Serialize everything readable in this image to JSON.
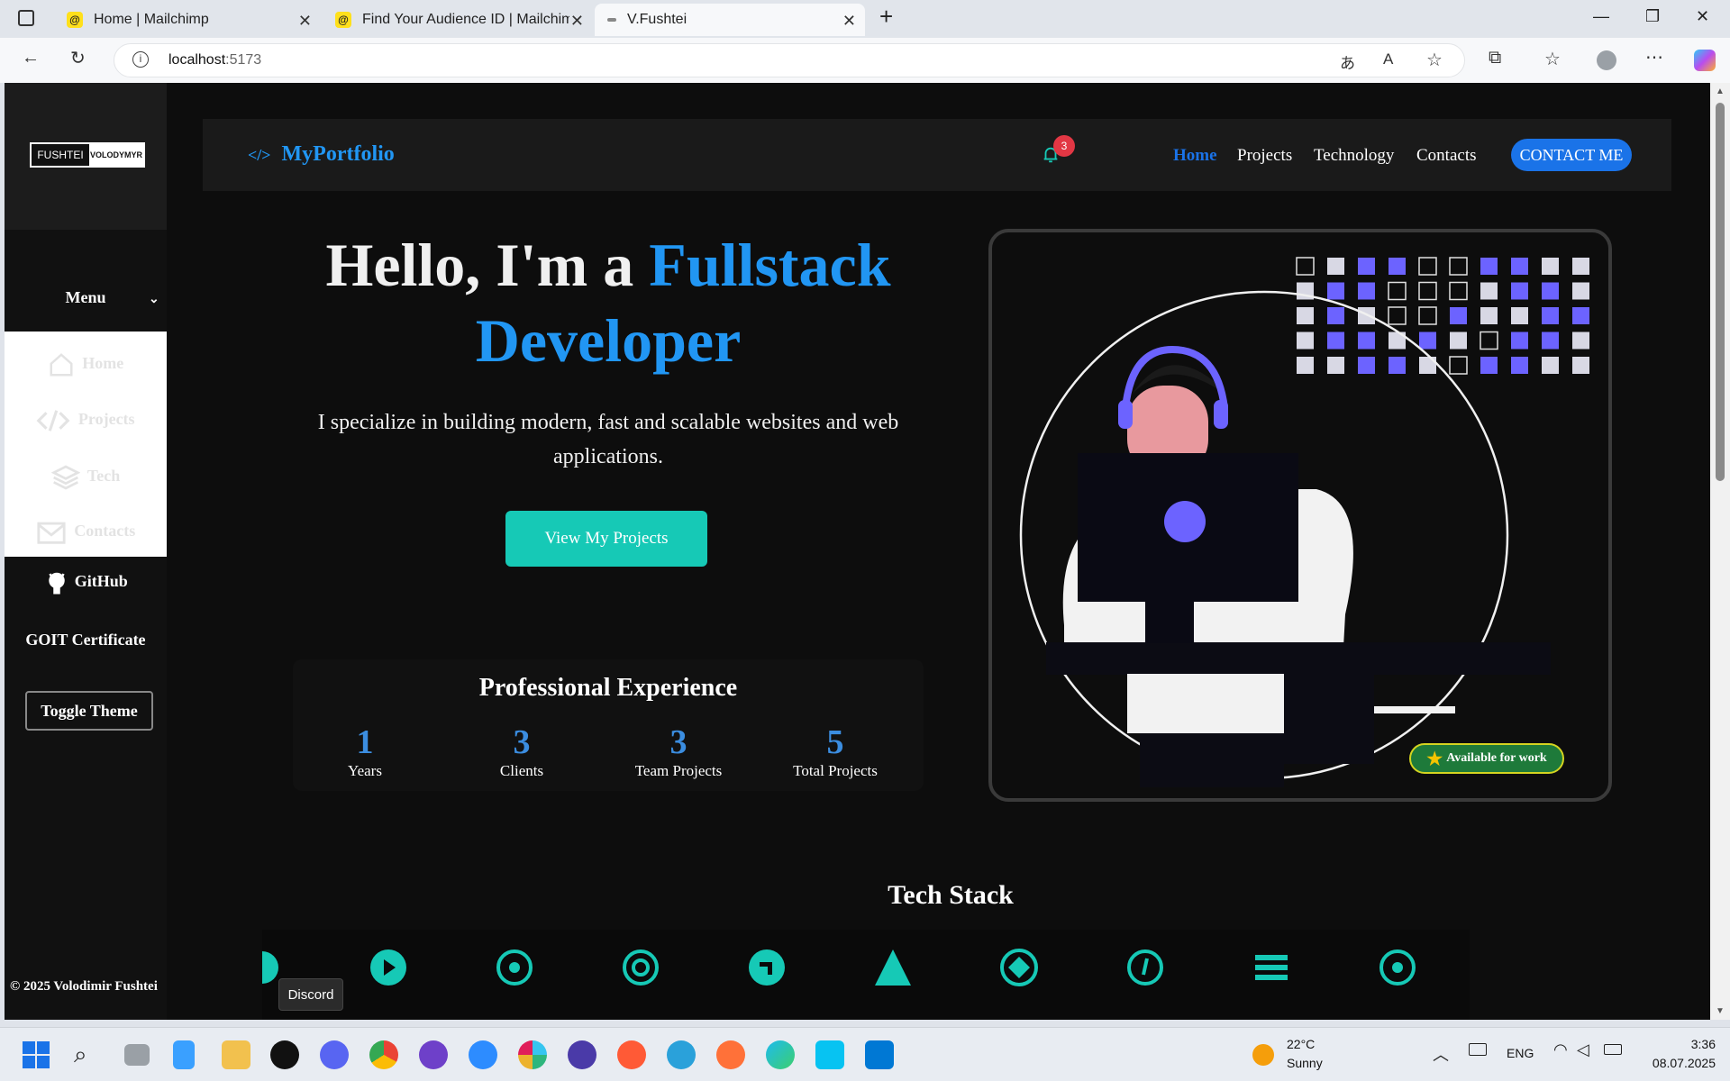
{
  "browser": {
    "tabs": [
      {
        "title": "Home | Mailchimp",
        "favicon": "mailchimp-icon"
      },
      {
        "title": "Find Your Audience ID | Mailchimp",
        "favicon": "mailchimp-icon"
      },
      {
        "title": "V.Fushtei",
        "favicon": "site-icon",
        "active": true
      }
    ],
    "url_host": "localhost",
    "url_port": ":5173"
  },
  "sidebar": {
    "logo_left": "FUSHTEI",
    "logo_right": "VOLODYMYR",
    "menu_label": "Menu",
    "items": [
      {
        "label": "Home",
        "icon": "home-icon"
      },
      {
        "label": "Projects",
        "icon": "code-icon"
      },
      {
        "label": "Tech",
        "icon": "layers-icon"
      },
      {
        "label": "Contacts",
        "icon": "mail-icon"
      }
    ],
    "github_label": "GitHub",
    "certificate_label": "GOIT Certificate",
    "toggle_theme_label": "Toggle Theme",
    "copyright": "© 2025 Volodimir Fushtei"
  },
  "header": {
    "brand": "MyPortfolio",
    "notification_count": "3",
    "nav": [
      "Home",
      "Projects",
      "Technology",
      "Contacts"
    ],
    "active_nav": "Home",
    "contact_button": "CONTACT ME"
  },
  "hero": {
    "title_plain": "Hello, I'm a ",
    "title_highlight_1": "Fullstack",
    "title_highlight_2": "Developer",
    "subtitle": "I specialize in building modern, fast and scalable websites and web applications.",
    "cta": "View My Projects",
    "available_badge": "Available for work"
  },
  "experience": {
    "title": "Professional Experience",
    "stats": [
      {
        "value": "1",
        "label": "Years"
      },
      {
        "value": "3",
        "label": "Clients"
      },
      {
        "value": "3",
        "label": "Team Projects"
      },
      {
        "value": "5",
        "label": "Total Projects"
      }
    ]
  },
  "tech": {
    "title": "Tech Stack",
    "icons": [
      "play-icon",
      "target-icon",
      "refresh-icon",
      "arrow-icon",
      "triangle-icon",
      "diamond-icon",
      "clock-icon",
      "menu-icon",
      "target-icon"
    ],
    "accent": "#16c9b6"
  },
  "tooltip": "Discord",
  "taskbar": {
    "weather_temp": "22°C",
    "weather_desc": "Sunny",
    "lang": "ENG",
    "time": "3:36",
    "date": "08.07.2025"
  },
  "colors": {
    "accent_blue": "#2196f3",
    "teal": "#16c9b6",
    "purple": "#6c63ff"
  }
}
